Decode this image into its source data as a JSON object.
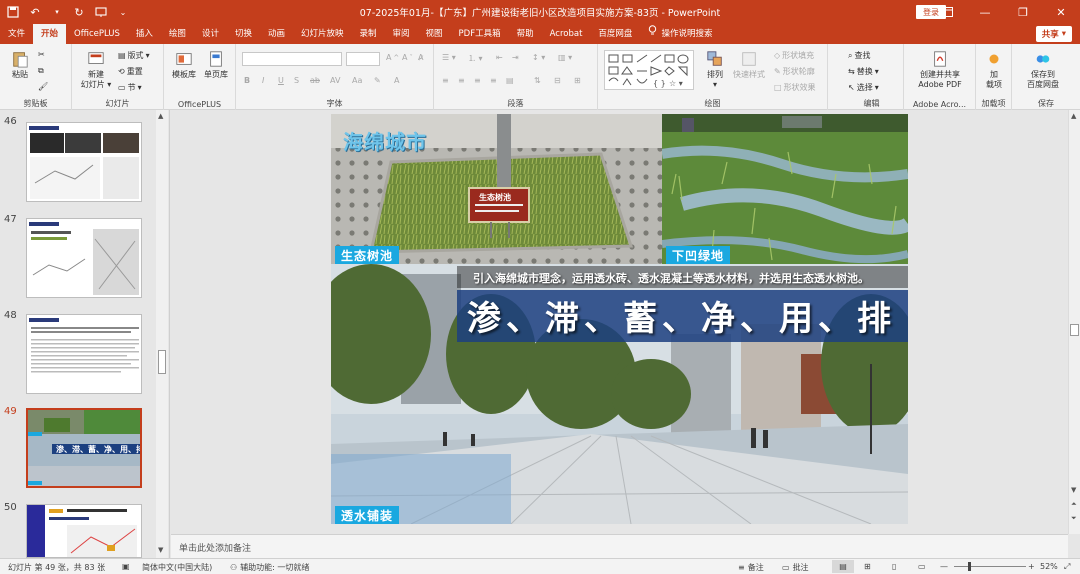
{
  "window": {
    "title": "07-2025年01月-【广东】广州建设街老旧小区改造项目实施方案-83页  -  PowerPoint",
    "login_label": "登录",
    "share_label": "共享"
  },
  "tabs": [
    "文件",
    "开始",
    "OfficePLUS",
    "插入",
    "绘图",
    "设计",
    "切换",
    "动画",
    "幻灯片放映",
    "录制",
    "审阅",
    "视图",
    "PDF工具箱",
    "帮助",
    "Acrobat",
    "百度网盘",
    "操作说明搜索"
  ],
  "active_tab": "开始",
  "ribbon": {
    "groups": {
      "clipboard": "剪贴板",
      "slides": "幻灯片",
      "officeplus": "OfficePLUS",
      "font": "字体",
      "paragraph": "段落",
      "drawing": "绘图",
      "editing": "编辑",
      "adobe": "Adobe Acro...",
      "addins": "加载项",
      "save": "保存"
    },
    "paste": "粘贴",
    "new_slide": "新建\n幻灯片",
    "layout": "版式",
    "reset": "重置",
    "section": "节",
    "template_lib": "模板库",
    "single_page_lib": "单页库",
    "arrange": "排列",
    "quick_styles": "快速样式",
    "shape_fill": "形状填充",
    "shape_outline": "形状轮廓",
    "shape_effects": "形状效果",
    "find": "查找",
    "replace": "替换",
    "select": "选择",
    "create_share_pdf": "创建并共享\nAdobe PDF",
    "addin_button": "加\n载项",
    "save_to_baidu": "保存到\n百度网盘"
  },
  "thumbnails": [
    {
      "num": "46"
    },
    {
      "num": "47"
    },
    {
      "num": "48"
    },
    {
      "num": "49",
      "active": true
    },
    {
      "num": "50"
    }
  ],
  "slide": {
    "title_watermark": "海绵城市",
    "caption_tree_pit": "生态树池",
    "caption_sunken_green": "下凹绿地",
    "caption_permeable": "透水铺装",
    "subline": "引入海绵城市理念，运用透水砖、透水混凝土等透水材料，并选用生态透水树池。",
    "headline": "渗、滞、蓄、净、用、排",
    "sign_text": "生态树池"
  },
  "notes_placeholder": "单击此处添加备注",
  "status": {
    "slide_pos": "幻灯片 第 49 张，共 83 张",
    "language": "简体中文(中国大陆)",
    "accessibility": "辅助功能: 一切就绪",
    "notes_btn": "备注",
    "comments_btn": "批注",
    "zoom": "52%"
  },
  "colors": {
    "accent": "#c43e1c",
    "caption_blue": "#1aa8e0",
    "headline_band": "#1c4080"
  }
}
